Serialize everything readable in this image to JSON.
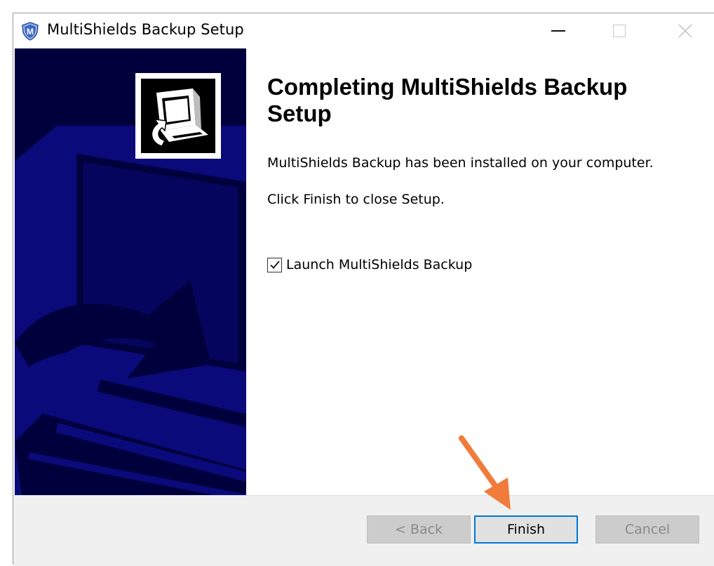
{
  "window": {
    "title": "MultiShields Backup Setup",
    "icon": "shield-m-icon",
    "icon_letter": "M"
  },
  "title_controls": {
    "minimize_icon": "minimize-icon",
    "maximize_icon": "maximize-icon",
    "close_icon": "close-icon"
  },
  "sidebar": {
    "background_color": "#00003c",
    "image_icon": "computer-install-icon"
  },
  "main": {
    "heading": "Completing MultiShields Backup Setup",
    "message": "MultiShields Backup has been installed on your computer.",
    "instruction": "Click Finish to close Setup.",
    "launch_checkbox": {
      "label": "Launch MultiShields Backup",
      "checked": true
    }
  },
  "footer": {
    "back_label": "< Back",
    "finish_label": "Finish",
    "cancel_label": "Cancel"
  },
  "annotation": {
    "arrow_color": "#f07b3a",
    "target": "finish-button"
  }
}
